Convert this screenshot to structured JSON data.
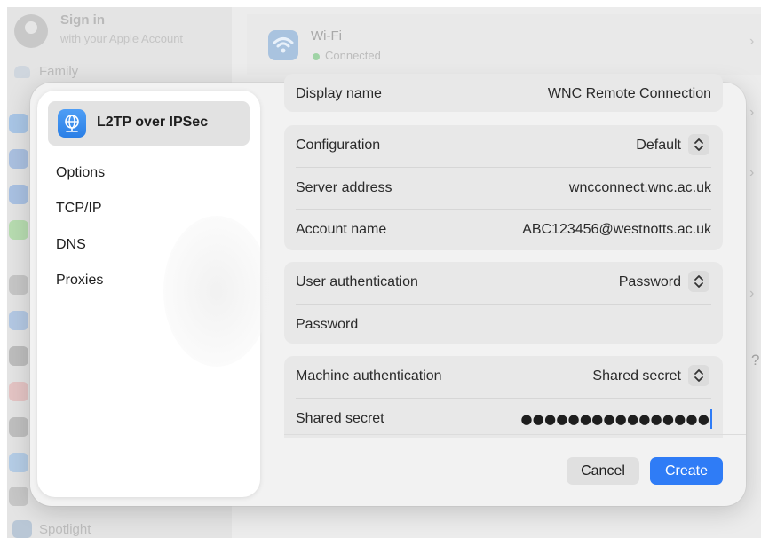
{
  "background": {
    "sidebar": {
      "signin_title": "Sign in",
      "signin_subtitle": "with your Apple Account",
      "family_label": "Family",
      "spotlight_label": "Spotlight"
    },
    "wifi": {
      "title": "Wi-Fi",
      "status": "Connected"
    },
    "help_glyph": "?",
    "chevron_glyph": "›"
  },
  "sheet": {
    "sidebar": {
      "selected_item": "L2TP over IPSec",
      "items": [
        "Options",
        "TCP/IP",
        "DNS",
        "Proxies"
      ]
    },
    "fields": {
      "display_name": {
        "label": "Display name",
        "value": "WNC Remote Connection"
      },
      "configuration": {
        "label": "Configuration",
        "value": "Default"
      },
      "server_address": {
        "label": "Server address",
        "value": "wncconnect.wnc.ac.uk"
      },
      "account_name": {
        "label": "Account name",
        "value": "ABC123456@westnotts.ac.uk"
      },
      "user_authentication": {
        "label": "User authentication",
        "value": "Password"
      },
      "password": {
        "label": "Password",
        "value": ""
      },
      "machine_authentication": {
        "label": "Machine authentication",
        "value": "Shared secret"
      },
      "shared_secret": {
        "label": "Shared secret",
        "value": "●●●●●●●●●●●●●●●●"
      }
    },
    "buttons": {
      "cancel": "Cancel",
      "create": "Create"
    }
  },
  "colors": {
    "accent": "#2f7cf6",
    "connected_dot": "#9fd3a5"
  }
}
